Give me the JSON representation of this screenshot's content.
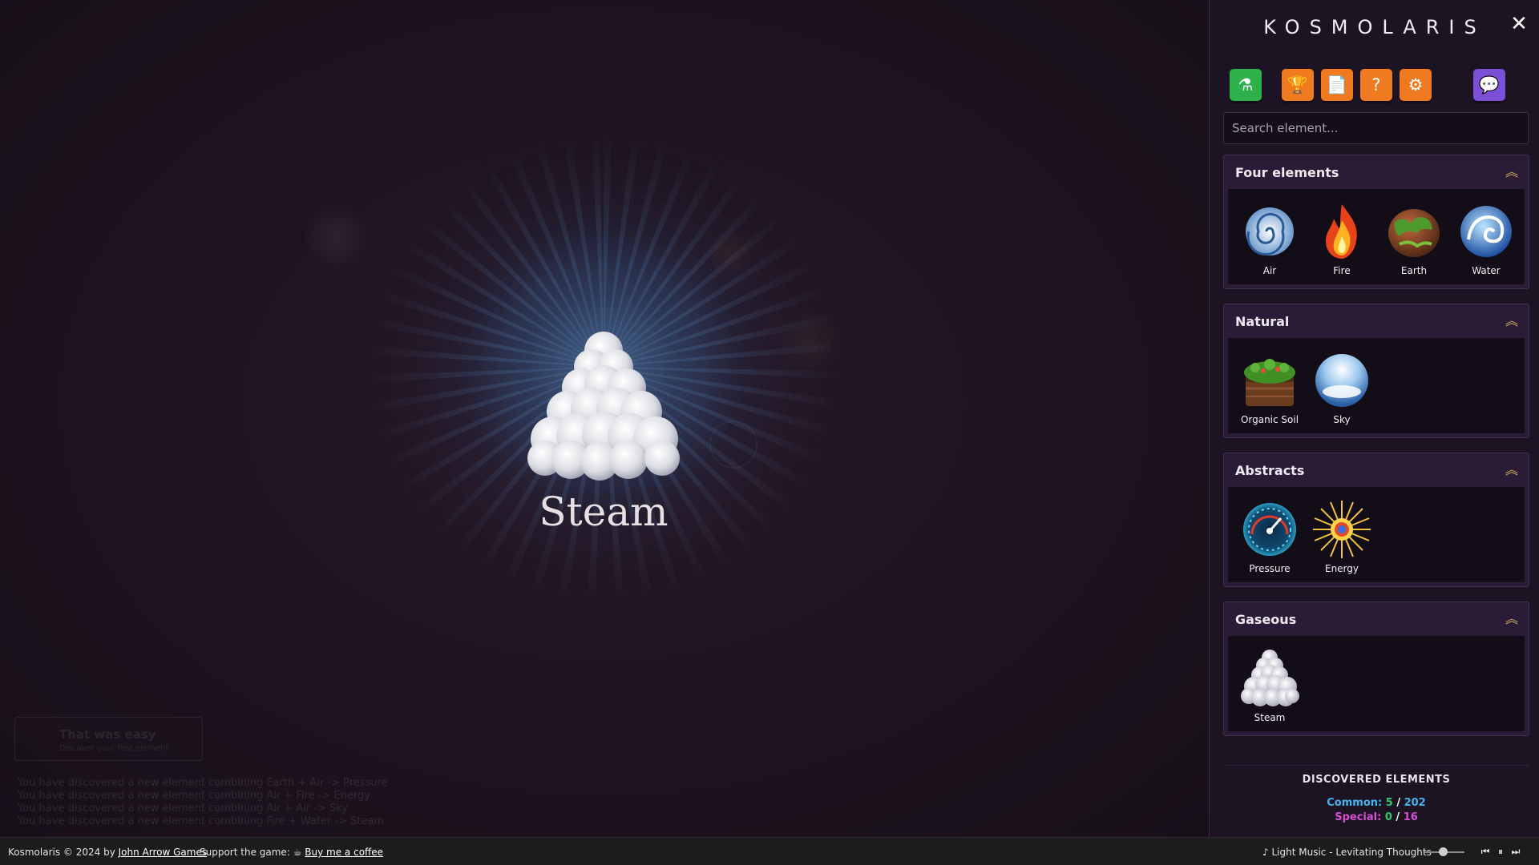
{
  "stage": {
    "featured_name": "Steam",
    "toast_title": "That was easy",
    "toast_subtitle": "Discover your first element",
    "log": [
      "You have discovered a new element combining Earth + Air -> Pressure",
      "You have discovered a new element combining Air + Fire -> Energy",
      "You have discovered a new element combining Air + Air -> Sky",
      "You have discovered a new element combining Fire + Water -> Steam"
    ]
  },
  "sidebar": {
    "logo": "KOSMOLARIS",
    "close_label": "✕",
    "toolbar": [
      {
        "name": "lab-flask-button",
        "icon": "flask-icon",
        "color": "#2eb14b",
        "glyph": "⚗"
      },
      {
        "name": "trophy-button",
        "icon": "trophy-icon",
        "color": "#f07a1f",
        "glyph": "🏆"
      },
      {
        "name": "notes-button",
        "icon": "document-icon",
        "color": "#f07a1f",
        "glyph": "📄"
      },
      {
        "name": "help-button",
        "icon": "question-icon",
        "color": "#f07a1f",
        "glyph": "?"
      },
      {
        "name": "settings-button",
        "icon": "gear-icon",
        "color": "#f07a1f",
        "glyph": "⚙"
      },
      {
        "name": "chat-button",
        "icon": "chat-icon",
        "color": "#7b4fd6",
        "glyph": "💬"
      }
    ],
    "search_placeholder": "Search element...",
    "categories": [
      {
        "title": "Four elements",
        "items": [
          "Air",
          "Fire",
          "Earth",
          "Water"
        ]
      },
      {
        "title": "Natural",
        "items": [
          "Organic Soil",
          "Sky"
        ]
      },
      {
        "title": "Abstracts",
        "items": [
          "Pressure",
          "Energy"
        ]
      },
      {
        "title": "Gaseous",
        "items": [
          "Steam"
        ]
      }
    ],
    "discovered": {
      "title": "DISCOVERED ELEMENTS",
      "common_label": "Common:",
      "common_found": "5",
      "common_total": "202",
      "special_label": "Special:",
      "special_found": "0",
      "special_total": "16",
      "colors": {
        "common_label": "#46b3f0",
        "found": "#2ec96b",
        "special_label": "#d64fd0",
        "total_common": "#46b3f0",
        "total_special": "#d64fd0"
      }
    }
  },
  "footer": {
    "copyright": "Kosmolaris © 2024 by",
    "author": "John Arrow Games",
    "support_label": "Support the game:",
    "coffee_label": "Buy me a coffee",
    "music_note": "♪",
    "track": "Light Music - Levitating Thoughts",
    "volume_fraction": 0.45
  }
}
